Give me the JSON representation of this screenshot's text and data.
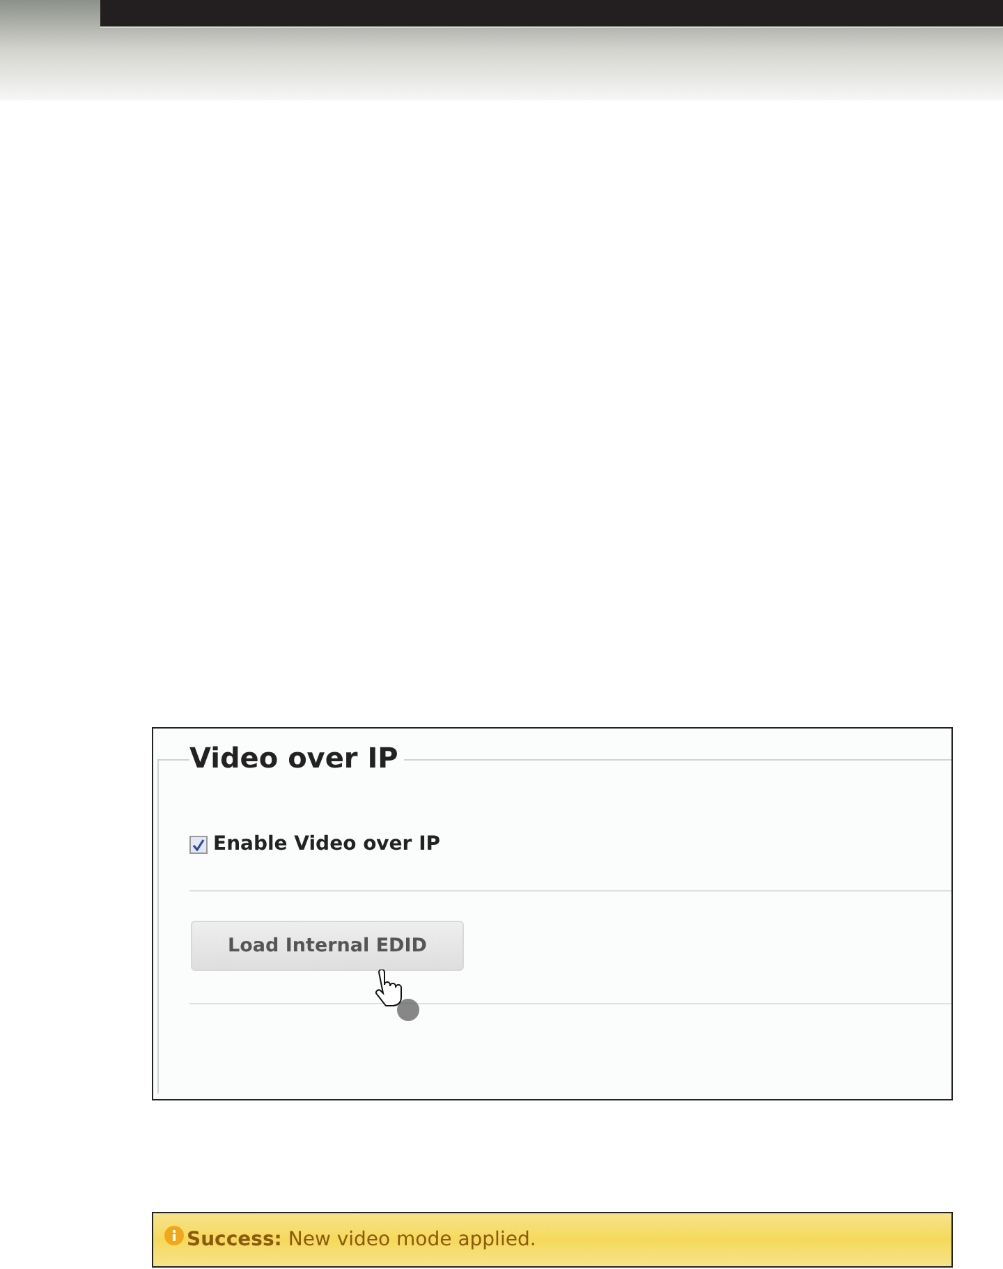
{
  "panel": {
    "legend": "Video over IP",
    "checkbox": {
      "label": "Enable Video over IP",
      "checked": true
    },
    "button": {
      "label": "Load Internal EDID"
    }
  },
  "message": {
    "text": "**Success:** New video mode applied."
  }
}
